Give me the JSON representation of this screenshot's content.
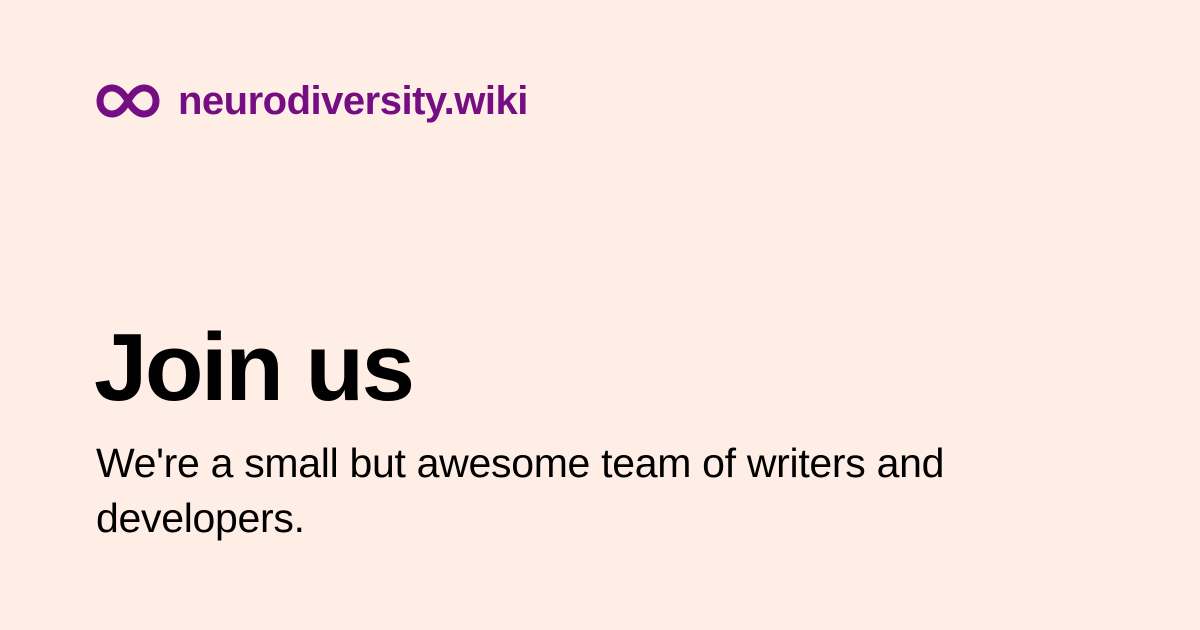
{
  "colors": {
    "background": "#FEEEE6",
    "brand": "#750D83",
    "text": "#000000"
  },
  "brand": {
    "icon": "infinity-icon",
    "name": "neurodiversity.wiki"
  },
  "headline": "Join us",
  "subtitle": "We're a small but awesome team of writers and developers."
}
